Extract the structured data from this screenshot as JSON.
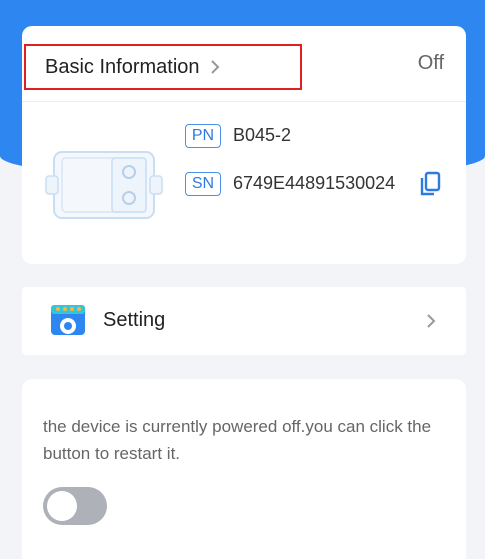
{
  "basic_info": {
    "title": "Basic Information",
    "status": "Off",
    "pn_tag": "PN",
    "pn_value": "B045-2",
    "sn_tag": "SN",
    "sn_value": "6749E44891530024"
  },
  "setting": {
    "label": "Setting"
  },
  "power": {
    "message": "the device is currently powered off.you can click the button to restart it.",
    "toggle_on": false
  },
  "colors": {
    "accent": "#2e87f0",
    "highlight_border": "#e02020",
    "tag_blue": "#2e7be0",
    "toggle_off": "#aeb1b7"
  },
  "icons": [
    "chevron-right-icon",
    "device-image",
    "copy-icon",
    "setting-icon"
  ]
}
